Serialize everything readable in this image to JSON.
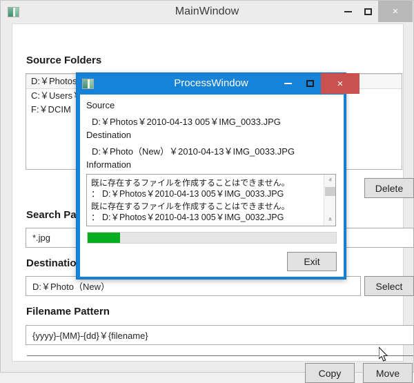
{
  "main_window": {
    "title": "MainWindow",
    "icon": "app-window-icon",
    "titlebar": {
      "minimize": "–",
      "maximize": "□",
      "close": "×"
    },
    "source_folders": {
      "label": "Source Folders",
      "items": [
        "D:￥Photos",
        "C:￥Users￥Hidetoshi￥OneDrive￥画像￥カメラロール",
        "F:￥DCIM"
      ],
      "selected_index": 0,
      "delete_button": "Delete"
    },
    "search_pattern": {
      "label": "Search Pattern",
      "value": "*.jpg"
    },
    "destination": {
      "label": "Destination",
      "value": "D:￥Photo（New）",
      "select_button": "Select"
    },
    "filename_pattern": {
      "label": "Filename Pattern",
      "value": "{yyyy}-{MM}-{dd}￥{filename}"
    },
    "actions": {
      "copy_button": "Copy",
      "move_button": "Move"
    }
  },
  "process_window": {
    "title": "ProcessWindow",
    "icon": "app-window-icon",
    "titlebar": {
      "minimize": "–",
      "maximize": "□",
      "close": "×"
    },
    "source": {
      "label": "Source",
      "value": "D:￥Photos￥2010-04-13 005￥IMG_0033.JPG"
    },
    "destination": {
      "label": "Destination",
      "value": "D:￥Photo（New）￥2010-04-13￥IMG_0033.JPG"
    },
    "information": {
      "label": "Information",
      "entries": [
        {
          "message": "既に存在するファイルを作成することはできません。",
          "path": "： D:￥Photos￥2010-04-13 005￥IMG_0033.JPG"
        },
        {
          "message": "既に存在するファイルを作成することはできません。",
          "path": "： D:￥Photos￥2010-04-13 005￥IMG_0032.JPG"
        }
      ],
      "scrollbar": {
        "up": "ⱏ",
        "down": "ⱞ"
      }
    },
    "progress": {
      "percent": 13
    },
    "exit_button": "Exit"
  },
  "colors": {
    "dialog_accent": "#1683d8",
    "close_red": "#c9514f",
    "progress_green": "#07ad20",
    "window_chrome": "#ececec"
  }
}
